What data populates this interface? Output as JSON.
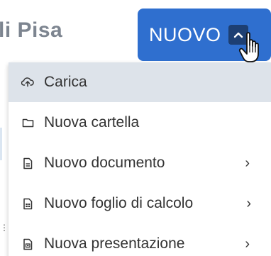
{
  "background": {
    "title": "li Pisa"
  },
  "new_button": {
    "label": "NUOVO",
    "chevron_icon": "chevron-up-icon",
    "color": "#2f6fcf"
  },
  "menu": {
    "items": [
      {
        "label": "Carica",
        "icon": "upload-cloud-icon",
        "has_submenu": false,
        "active": true
      },
      {
        "label": "Nuova cartella",
        "icon": "folder-icon",
        "has_submenu": false,
        "active": false
      },
      {
        "label": "Nuovo documento",
        "icon": "document-icon",
        "has_submenu": true,
        "active": false
      },
      {
        "label": "Nuovo foglio di calcolo",
        "icon": "spreadsheet-icon",
        "has_submenu": true,
        "active": false
      },
      {
        "label": "Nuova presentazione",
        "icon": "presentation-icon",
        "has_submenu": true,
        "active": false
      }
    ],
    "submenu_arrow": "›",
    "highlight_color": "#dde3ea"
  }
}
